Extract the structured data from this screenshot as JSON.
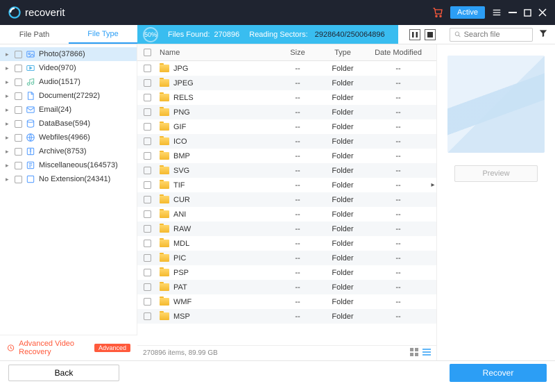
{
  "titlebar": {
    "brand": "recoverit",
    "active_label": "Active"
  },
  "sidebar_tabs": {
    "file_path": "File Path",
    "file_type": "File Type"
  },
  "progress": {
    "percent": "50%",
    "files_found_label": "Files Found:",
    "files_found": "270896",
    "reading_label": "Reading Sectors:",
    "reading_value": "2928640/250064896"
  },
  "search": {
    "placeholder": "Search file"
  },
  "categories": [
    {
      "label": "Photo(37866)",
      "icon": "photo",
      "selected": true
    },
    {
      "label": "Video(970)",
      "icon": "video",
      "selected": false
    },
    {
      "label": "Audio(1517)",
      "icon": "audio",
      "selected": false
    },
    {
      "label": "Document(27292)",
      "icon": "document",
      "selected": false
    },
    {
      "label": "Email(24)",
      "icon": "email",
      "selected": false
    },
    {
      "label": "DataBase(594)",
      "icon": "database",
      "selected": false
    },
    {
      "label": "Webfiles(4966)",
      "icon": "webfiles",
      "selected": false
    },
    {
      "label": "Archive(8753)",
      "icon": "archive",
      "selected": false
    },
    {
      "label": "Miscellaneous(164573)",
      "icon": "misc",
      "selected": false
    },
    {
      "label": "No Extension(24341)",
      "icon": "noext",
      "selected": false
    }
  ],
  "advanced": {
    "label": "Advanced Video Recovery",
    "badge": "Advanced"
  },
  "columns": {
    "name": "Name",
    "size": "Size",
    "type": "Type",
    "date": "Date Modified"
  },
  "rows": [
    {
      "name": "JPG",
      "size": "--",
      "type": "Folder",
      "date": "--"
    },
    {
      "name": "JPEG",
      "size": "--",
      "type": "Folder",
      "date": "--"
    },
    {
      "name": "RELS",
      "size": "--",
      "type": "Folder",
      "date": "--"
    },
    {
      "name": "PNG",
      "size": "--",
      "type": "Folder",
      "date": "--"
    },
    {
      "name": "GIF",
      "size": "--",
      "type": "Folder",
      "date": "--"
    },
    {
      "name": "ICO",
      "size": "--",
      "type": "Folder",
      "date": "--"
    },
    {
      "name": "BMP",
      "size": "--",
      "type": "Folder",
      "date": "--"
    },
    {
      "name": "SVG",
      "size": "--",
      "type": "Folder",
      "date": "--"
    },
    {
      "name": "TIF",
      "size": "--",
      "type": "Folder",
      "date": "--",
      "marked": true
    },
    {
      "name": "CUR",
      "size": "--",
      "type": "Folder",
      "date": "--"
    },
    {
      "name": "ANI",
      "size": "--",
      "type": "Folder",
      "date": "--"
    },
    {
      "name": "RAW",
      "size": "--",
      "type": "Folder",
      "date": "--"
    },
    {
      "name": "MDL",
      "size": "--",
      "type": "Folder",
      "date": "--"
    },
    {
      "name": "PIC",
      "size": "--",
      "type": "Folder",
      "date": "--"
    },
    {
      "name": "PSP",
      "size": "--",
      "type": "Folder",
      "date": "--"
    },
    {
      "name": "PAT",
      "size": "--",
      "type": "Folder",
      "date": "--"
    },
    {
      "name": "WMF",
      "size": "--",
      "type": "Folder",
      "date": "--"
    },
    {
      "name": "MSP",
      "size": "--",
      "type": "Folder",
      "date": "--"
    }
  ],
  "status": {
    "summary": "270896 items, 89.99  GB"
  },
  "preview": {
    "button": "Preview"
  },
  "footer": {
    "back": "Back",
    "recover": "Recover"
  },
  "icon_colors": {
    "photo": "#5aa0ff",
    "video": "#55b5e6",
    "audio": "#6ac6a8",
    "document": "#5aa0ff",
    "email": "#5aa0ff",
    "database": "#5aa0ff",
    "webfiles": "#5aa0ff",
    "archive": "#5aa0ff",
    "misc": "#5aa0ff",
    "noext": "#5aa0ff"
  }
}
